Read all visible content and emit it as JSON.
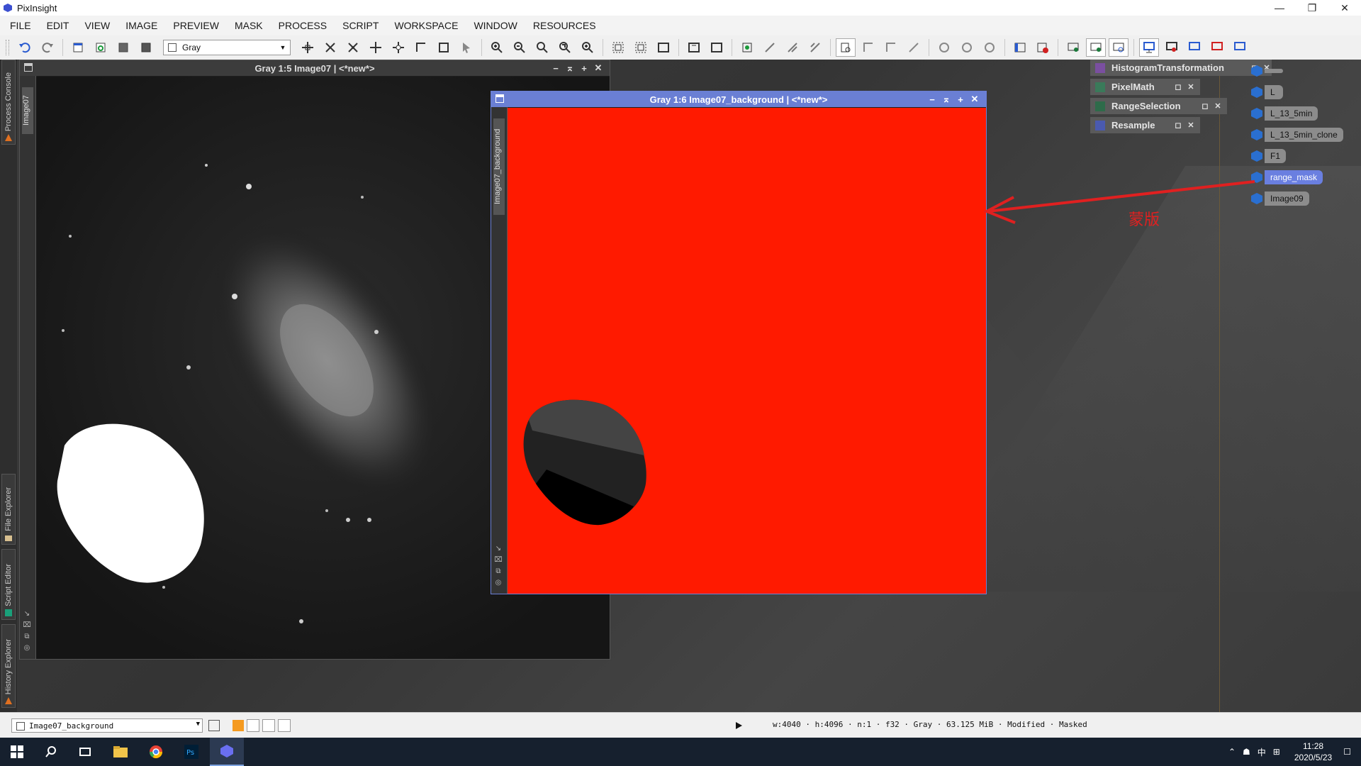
{
  "app": {
    "title": "PixInsight",
    "window_controls": [
      "—",
      "❐",
      "✕"
    ]
  },
  "menu": [
    "FILE",
    "EDIT",
    "VIEW",
    "IMAGE",
    "PREVIEW",
    "MASK",
    "PROCESS",
    "SCRIPT",
    "WORKSPACE",
    "WINDOW",
    "RESOURCES"
  ],
  "toolbar": {
    "color_mode": "Gray"
  },
  "side_tabs": {
    "process_console": "Process Console",
    "file_explorer": "File Explorer",
    "script_editor": "Script Editor",
    "history_explorer": "History Explorer"
  },
  "image_window_1": {
    "title": "Gray 1:5 Image07 | <*new*>",
    "side_label": "Image07"
  },
  "image_window_2": {
    "title": "Gray 1:6 Image07_background | <*new*>",
    "side_label": "Image07_background",
    "canvas_color": "#ff1a00"
  },
  "process_icons": [
    {
      "label": "HistogramTransformation"
    },
    {
      "label": "PixelMath"
    },
    {
      "label": "RangeSelection"
    },
    {
      "label": "Resample"
    }
  ],
  "image_icons": [
    {
      "label": "",
      "selected": false
    },
    {
      "label": "L",
      "selected": false
    },
    {
      "label": "L_13_5min",
      "selected": false
    },
    {
      "label": "L_13_5min_clone",
      "selected": false
    },
    {
      "label": "F1",
      "selected": false
    },
    {
      "label": "range_mask",
      "selected": true
    },
    {
      "label": "Image09",
      "selected": false
    }
  ],
  "annotation": {
    "text": "蒙版",
    "color": "#e02020"
  },
  "status": {
    "active_view": "Image07_background",
    "info": "w:4040 · h:4096 · n:1 · f32 · Gray · 63.125 MiB · Modified · Masked"
  },
  "taskbar": {
    "clock_time": "11:28",
    "clock_date": "2020/5/23",
    "ime": "中"
  }
}
